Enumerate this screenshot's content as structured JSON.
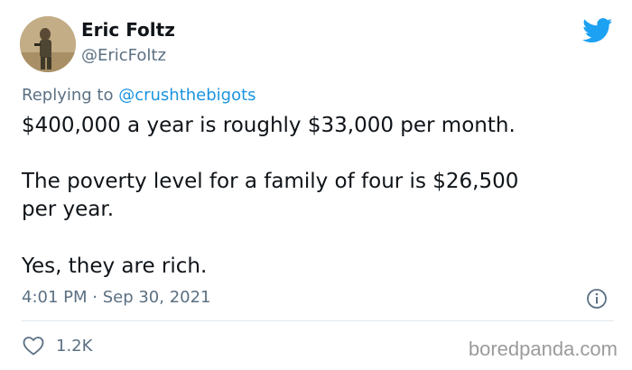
{
  "author": {
    "name": "Eric Foltz",
    "handle": "@EricFoltz",
    "avatar_icon": "person-photo-avatar"
  },
  "reply": {
    "prefix": "Replying to",
    "mention": "@crushthebigots"
  },
  "tweet": {
    "lines": [
      "$400,000 a year is roughly $33,000 per month.",
      "The poverty level for a family of four is $26,500",
      "per year.",
      "Yes, they are rich."
    ],
    "timestamp": "4:01 PM · Sep 30, 2021",
    "likes": "1.2K"
  },
  "icons": {
    "brand": "twitter-bird-icon",
    "info": "info-icon",
    "like": "heart-icon"
  },
  "watermark": "boredpanda.com",
  "colors": {
    "twitter_blue": "#1da1f2",
    "link_blue": "#1b95e0",
    "muted_text": "#5b7083",
    "text": "#0f1419"
  }
}
